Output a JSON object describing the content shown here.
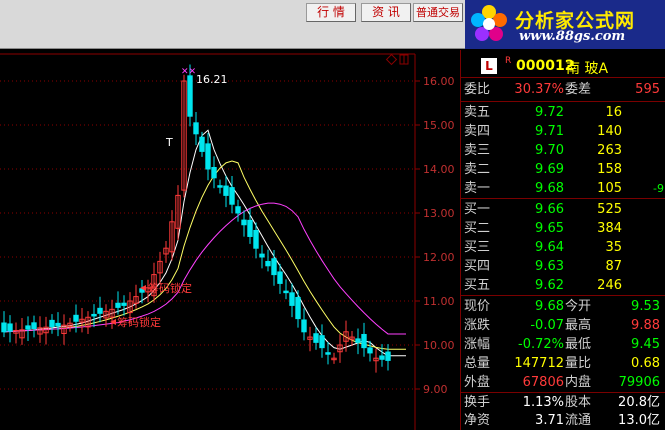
{
  "toolbar": {
    "buttons": [
      {
        "label": "行 情"
      },
      {
        "label": "资 讯"
      },
      {
        "label": "普通交易"
      }
    ]
  },
  "logo": {
    "brand": "分析家公式网",
    "url": "www.88gs.com"
  },
  "chart": {
    "y_ticks": [
      "16.00",
      "15.00",
      "14.00",
      "13.00",
      "12.00",
      "11.00",
      "10.00",
      "9.00"
    ],
    "peak_label": "16.21",
    "t_label": "T",
    "annotations": [
      {
        "text": "筹码锁定"
      },
      {
        "text": "筹码锁定"
      }
    ]
  },
  "quote": {
    "badge": "L",
    "rmark": "R",
    "code": "000012",
    "name": "南 玻A",
    "wei_bi_label": "委比",
    "wei_bi": "30.37%",
    "wei_cha_label": "委差",
    "wei_cha": "595",
    "asks": [
      {
        "label": "卖五",
        "price": "9.72",
        "vol": "16",
        "chg": ""
      },
      {
        "label": "卖四",
        "price": "9.71",
        "vol": "140",
        "chg": ""
      },
      {
        "label": "卖三",
        "price": "9.70",
        "vol": "263",
        "chg": ""
      },
      {
        "label": "卖二",
        "price": "9.69",
        "vol": "158",
        "chg": ""
      },
      {
        "label": "卖一",
        "price": "9.68",
        "vol": "105",
        "chg": "-9"
      }
    ],
    "bids": [
      {
        "label": "买一",
        "price": "9.66",
        "vol": "525"
      },
      {
        "label": "买二",
        "price": "9.65",
        "vol": "384"
      },
      {
        "label": "买三",
        "price": "9.64",
        "vol": "35"
      },
      {
        "label": "买四",
        "price": "9.63",
        "vol": "87"
      },
      {
        "label": "买五",
        "price": "9.62",
        "vol": "246"
      }
    ],
    "stats": [
      {
        "l1": "现价",
        "v1": "9.68",
        "c1": "green",
        "l2": "今开",
        "v2": "9.53",
        "c2": "green"
      },
      {
        "l1": "涨跌",
        "v1": "-0.07",
        "c1": "green",
        "l2": "最高",
        "v2": "9.88",
        "c2": "red"
      },
      {
        "l1": "涨幅",
        "v1": "-0.72%",
        "c1": "green",
        "l2": "最低",
        "v2": "9.45",
        "c2": "green"
      },
      {
        "l1": "总量",
        "v1": "147712",
        "c1": "yellow",
        "l2": "量比",
        "v2": "0.68",
        "c2": "yellow"
      },
      {
        "l1": "外盘",
        "v1": "67806",
        "c1": "red",
        "l2": "内盘",
        "v2": "79906",
        "c2": "green"
      }
    ],
    "stats2": [
      {
        "l1": "换手",
        "v1": "1.13%",
        "l2": "股本",
        "v2": "20.8亿"
      },
      {
        "l1": "净资",
        "v1": "3.71",
        "l2": "流通",
        "v2": "13.0亿"
      }
    ]
  },
  "colors": {
    "up": "#ff3a3a",
    "down": "#00e5ee",
    "ma_white": "#ffffff",
    "ma_yellow": "#ffff66",
    "ma_magenta": "#ff40ff",
    "grid": "#8b0000"
  }
}
